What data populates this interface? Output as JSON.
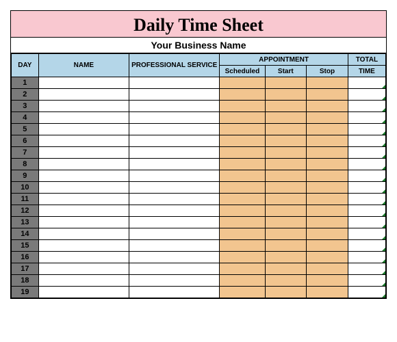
{
  "title": "Daily Time Sheet",
  "business": "Your Business Name",
  "headers": {
    "day": "DAY",
    "name": "NAME",
    "prof": "PROFESSIONAL SERVICE",
    "appt": "APPOINTMENT",
    "sched": "Scheduled",
    "start": "Start",
    "stop": "Stop",
    "total_top": "TOTAL",
    "total_bot": "TIME"
  },
  "rows": [
    {
      "day": "1"
    },
    {
      "day": "2"
    },
    {
      "day": "3"
    },
    {
      "day": "4"
    },
    {
      "day": "5"
    },
    {
      "day": "6"
    },
    {
      "day": "7"
    },
    {
      "day": "8"
    },
    {
      "day": "9"
    },
    {
      "day": "10"
    },
    {
      "day": "11"
    },
    {
      "day": "12"
    },
    {
      "day": "13"
    },
    {
      "day": "14"
    },
    {
      "day": "15"
    },
    {
      "day": "16"
    },
    {
      "day": "17"
    },
    {
      "day": "18"
    },
    {
      "day": "19"
    }
  ]
}
